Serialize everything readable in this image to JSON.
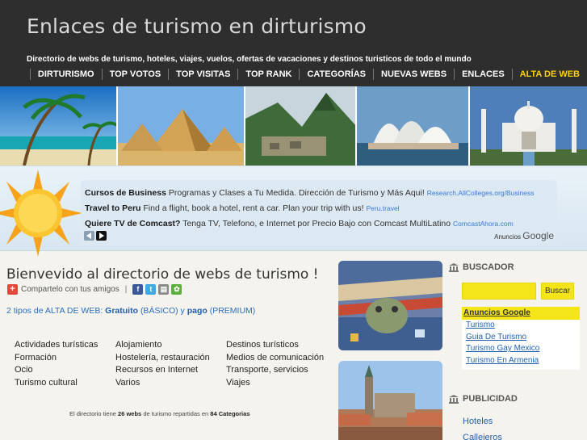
{
  "header": {
    "title": "Enlaces de turismo en dirturismo",
    "tagline": "Directorio de webs de turismo, hoteles, viajes, vuelos, ofertas de vacaciones y destinos turisticos de todo el mundo"
  },
  "nav": [
    {
      "label": "DIRTURISMO"
    },
    {
      "label": "TOP VOTOS"
    },
    {
      "label": "TOP VISITAS"
    },
    {
      "label": "TOP RANK"
    },
    {
      "label": "CATEGORÍAS"
    },
    {
      "label": "NUEVAS WEBS"
    },
    {
      "label": "ENLACES"
    },
    {
      "label": "ALTA DE WEB"
    }
  ],
  "ads": [
    {
      "title": "Cursos de Business",
      "text": "Programas y Clases a Tu Medida. Dirección de Turismo y Más Aqui!",
      "url": "Research.AllColleges.org/Business"
    },
    {
      "title": "Travel to Peru",
      "text": "Find a flight, book a hotel, rent a car. Plan your trip with us!",
      "url": "Peru.travel"
    },
    {
      "title": "Quiere TV de Comcast?",
      "text": "Tenga TV, Telefono, e Internet por Precio Bajo con Comcast MultiLatino",
      "url": "ComcastAhora.com"
    }
  ],
  "ads_by": {
    "label": "Anuncios",
    "brand": "Google"
  },
  "main": {
    "title": "Bienvevido al directorio de webs de turismo !",
    "share_label": "Compartelo con tus amigos",
    "share_sep": "|",
    "alta": {
      "prefix": "2 tipos de ALTA DE WEB:",
      "free": "Gratuito",
      "free_note": "(BÁSICO)",
      "and": "y",
      "paid": "pago",
      "paid_note": "(PREMIUM)"
    },
    "categories": [
      "Actividades turísticas",
      "Alojamiento",
      "Destinos turísticos",
      "Formación",
      "Hostelería, restauración",
      "Medios de comunicación",
      "Ocio",
      "Recursos en Internet",
      "Transporte, servicios",
      "Turismo cultural",
      "Varios",
      "Viajes"
    ],
    "stats": {
      "prefix": "El directorio tiene",
      "webs": "26 webs",
      "middle": "de turismo repartidas en",
      "cats": "84 Categorias"
    }
  },
  "sidebar": {
    "search_title": "BUSCADOR",
    "search_value": "",
    "search_button": "Buscar",
    "ads_title": "Anuncios Google",
    "ad_links": [
      "Turismo",
      "Guia De Turismo",
      "Turismo Gay Mexico",
      "Turismo En Armenia"
    ],
    "publicidad_title": "PUBLICIDAD",
    "publicidad_links": [
      "Hoteles",
      "Callejeros"
    ]
  },
  "colors": {
    "header_bg": "#2e2e2e",
    "accent_yellow": "#f4e51b",
    "nav_highlight": "#ffd200",
    "link_blue": "#1f5fae"
  }
}
